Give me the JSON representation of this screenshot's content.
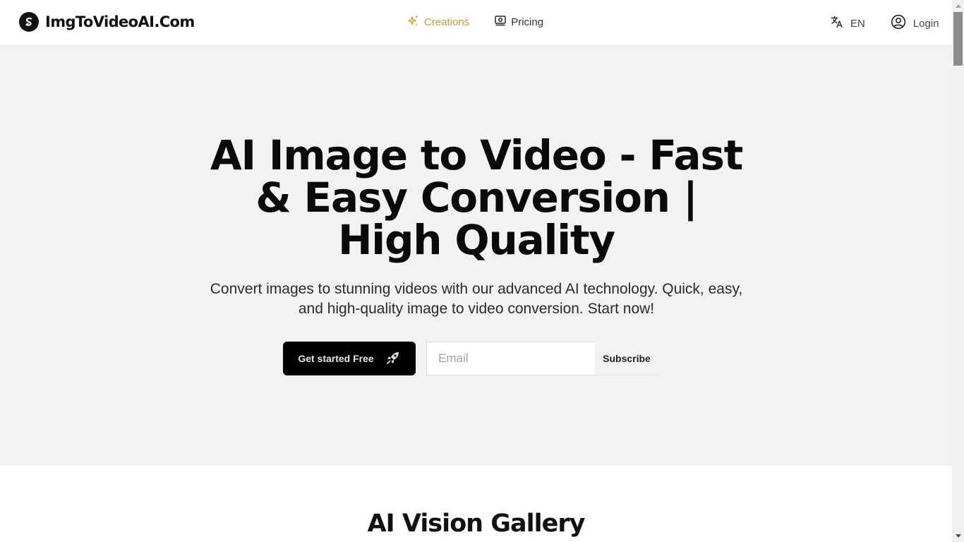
{
  "header": {
    "logo_text": "ImgToVideoAI.Com",
    "nav": [
      {
        "label": "Creations",
        "icon": "sparkles-icon",
        "active": true
      },
      {
        "label": "Pricing",
        "icon": "money-icon",
        "active": false
      }
    ],
    "language": {
      "label": "EN",
      "icon": "translate-icon"
    },
    "login": {
      "label": "Login",
      "icon": "user-circle-icon"
    }
  },
  "hero": {
    "title": "AI Image to Video - Fast & Easy Conversion | High Quality",
    "subtitle": "Convert images to stunning videos with our advanced AI technology. Quick, easy, and high-quality image to video conversion. Start now!",
    "cta_label": "Get started Free",
    "cta_icon": "rocket-icon",
    "email_placeholder": "Email",
    "email_value": "",
    "subscribe_label": "Subscribe"
  },
  "gallery": {
    "title": "AI Vision Gallery"
  },
  "colors": {
    "accent": "#c99a2e",
    "hero_bg": "#f2f2f2",
    "primary_button": "#000000"
  }
}
